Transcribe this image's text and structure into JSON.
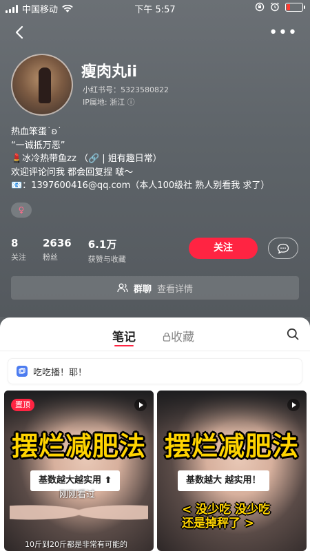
{
  "status_bar": {
    "carrier": "中国移动",
    "time": "下午 5:57"
  },
  "profile": {
    "name": "瘦肉丸ii",
    "id_text": "小红书号：5323580822",
    "ip_text": "IP属地: 浙江  ⓘ",
    "bio_lines": [
      "热血笨蛋˙ʚ˙",
      "“一诚抵万恶”",
      "💄冰冷热带鱼zz （🔗 | 姐有趣日常）",
      "欢迎评论问我 都会回复捏 啵～",
      "📧：1397600416@qq.com（本人100级社 熟人别看我 求了）"
    ],
    "gender": "♀"
  },
  "stats": [
    {
      "value": "8",
      "label": "关注"
    },
    {
      "value": "2636",
      "label": "粉丝"
    },
    {
      "value": "6.1万",
      "label": "获赞与收藏"
    }
  ],
  "actions": {
    "follow_label": "关注",
    "message_glyph": "⋯"
  },
  "group": {
    "label": "群聊",
    "detail": "查看详情"
  },
  "tabs": {
    "notes": "笔记",
    "favorites": "收藏"
  },
  "notice": {
    "text": "吃吃播！耶！"
  },
  "posts": [
    {
      "pin": "置顶",
      "title": "摆烂减肥法",
      "subtitle": "基数越大越实用 ⬆",
      "seen": "刚刚看过",
      "bottom": "10斤到20斤都是非常有可能的"
    },
    {
      "title": "摆烂减肥法",
      "subtitle": "基数越大 越实用！",
      "bottom_big": "< 没少吃 没少吃\n还是掉秤了 >"
    }
  ],
  "colors": {
    "accent": "#ff2442",
    "title_yellow": "#ffd400",
    "header_bg": "#5e6469"
  }
}
